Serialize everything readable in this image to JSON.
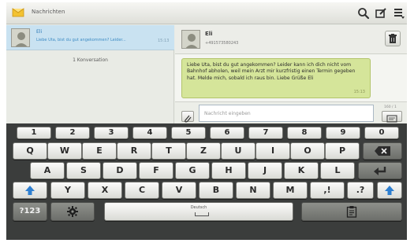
{
  "app": {
    "title": "Nachrichten",
    "icons": {
      "app": "envelope-icon",
      "search": "search-icon",
      "compose": "compose-icon",
      "menu": "menu-icon"
    }
  },
  "conversations": [
    {
      "name": "Eli",
      "preview": "Liebe Uta, bist du gut angekommen? Leider...",
      "time": "15:13"
    }
  ],
  "conversation_count": "1 Konversation",
  "chat": {
    "contact_name": "Eli",
    "contact_number": "+491573580243",
    "message_text": "Liebe Uta, bist du gut angekommen? Leider kann ich dich nicht vom Bahnhof abholen, weil mein Arzt mir kurzfristig einen Termin gegeben hat. Melde mich, sobald ich raus bin. Liebe Grüße Eli",
    "message_time": "15:13",
    "input_placeholder": "Nachricht eingeben",
    "char_counter": "160 / 1"
  },
  "keyboard": {
    "numbers": [
      "1",
      "2",
      "3",
      "4",
      "5",
      "6",
      "7",
      "8",
      "9",
      "0"
    ],
    "row1": [
      "Q",
      "W",
      "E",
      "R",
      "T",
      "Z",
      "U",
      "I",
      "O",
      "P"
    ],
    "row2": [
      "A",
      "S",
      "D",
      "F",
      "G",
      "H",
      "J",
      "K",
      "L"
    ],
    "row3": [
      "Y",
      "X",
      "C",
      "V",
      "B",
      "N",
      "M",
      ",!",
      ".?"
    ],
    "symbols_key": "?123",
    "space_label": "Deutsch",
    "colors": {
      "key_face": "#f0f0ee",
      "board": "#3b3d3c",
      "shift_blue": "#2e7fd0",
      "bubble": "#d5e59a",
      "selected_row": "#c9e2f1"
    }
  }
}
